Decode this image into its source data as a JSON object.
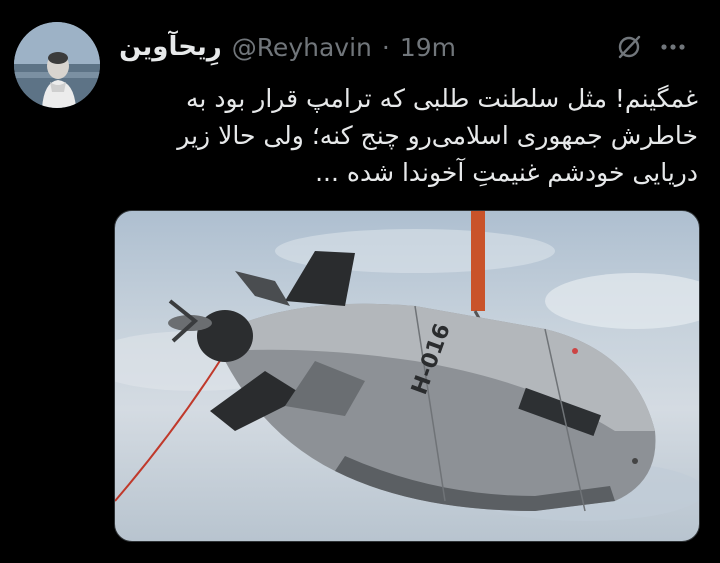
{
  "tweet": {
    "author_name": "رِیحآوین",
    "handle": "@Reyhavin",
    "separator": "·",
    "time": "19m",
    "text": "غمگینم! مثل سلطنت طلبی که ترامپ قرار بود به خاطرش جمهوری اسلامی‌رو چنج کنه؛ ولی حالا زیر دریایی خودشم غنیمتِ آخوندا شده ...",
    "image_markings": "H-016"
  },
  "icons": {
    "grok": "grok-slash-icon",
    "more": "more-dots-icon"
  },
  "colors": {
    "background": "#000000",
    "text": "#e7e9ea",
    "secondary": "#71767b"
  }
}
